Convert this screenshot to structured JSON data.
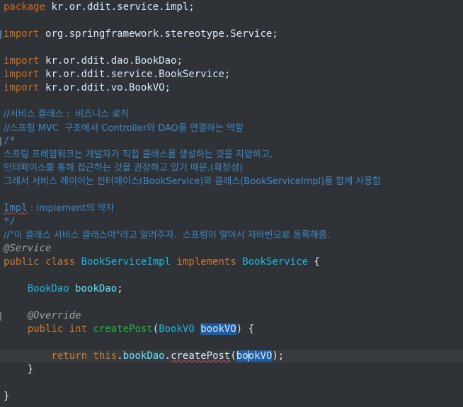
{
  "code": {
    "l1_kw": "package",
    "l1_name": "kr.or.ddit.service.impl;",
    "import_kw": "import",
    "l3_name": "org.springframework.stereotype.Service;",
    "l5_name": "kr.or.ddit.dao.BookDao;",
    "l6_name": "kr.or.ddit.service.BookService;",
    "l7_name": "kr.or.ddit.vo.BookVO;",
    "c1": "//서비스 클래스 :  비즈니스 로직",
    "c2": "//스프링 MVC  구조에서 Controller와 DAO를 연결하는 역할",
    "c3": "/*",
    "c4": "스프링 프레임워크는 개발자가 직접 클래스를 생성하는 것을 지양하고,",
    "c5": "인터페이스를 통해 접근하는 것을 권장하고 있기 때문.(확장성)",
    "c6": "그래서 서비스 레이어는 인터페이스(BookService)와 클래스(BookServiceImpl)를 함께 사용함",
    "c8_impl": "Impl",
    "c8_rest": " : implement의 약자",
    "c9": "*/",
    "c10": "//\"이 클래스 서비스 클래스야\"라고 알려주자.  스프링이 알아서 자바빈으로 등록해줌.",
    "ann_service": "@Service",
    "kw_public": "public",
    "kw_class": "class",
    "class_name": "BookServiceImpl",
    "kw_implements": "implements",
    "iface_name": "BookService",
    "brace_open": " {",
    "field_type": "BookDao",
    "field_name": "bookDao",
    "semicolon": ";",
    "ann_override": "@Override",
    "kw_int": "int",
    "method_name": "createPost",
    "paren_open": "(",
    "param_type": "BookVO",
    "param_name": "bookVO",
    "paren_close_brace": ") {",
    "kw_return": "return",
    "kw_this": "this",
    "dot": ".",
    "call_field": "bookDao",
    "call_method": "createPost",
    "arg_part1": "bo",
    "arg_part2": "okVO",
    "call_end": ");",
    "close_brace": "}"
  }
}
